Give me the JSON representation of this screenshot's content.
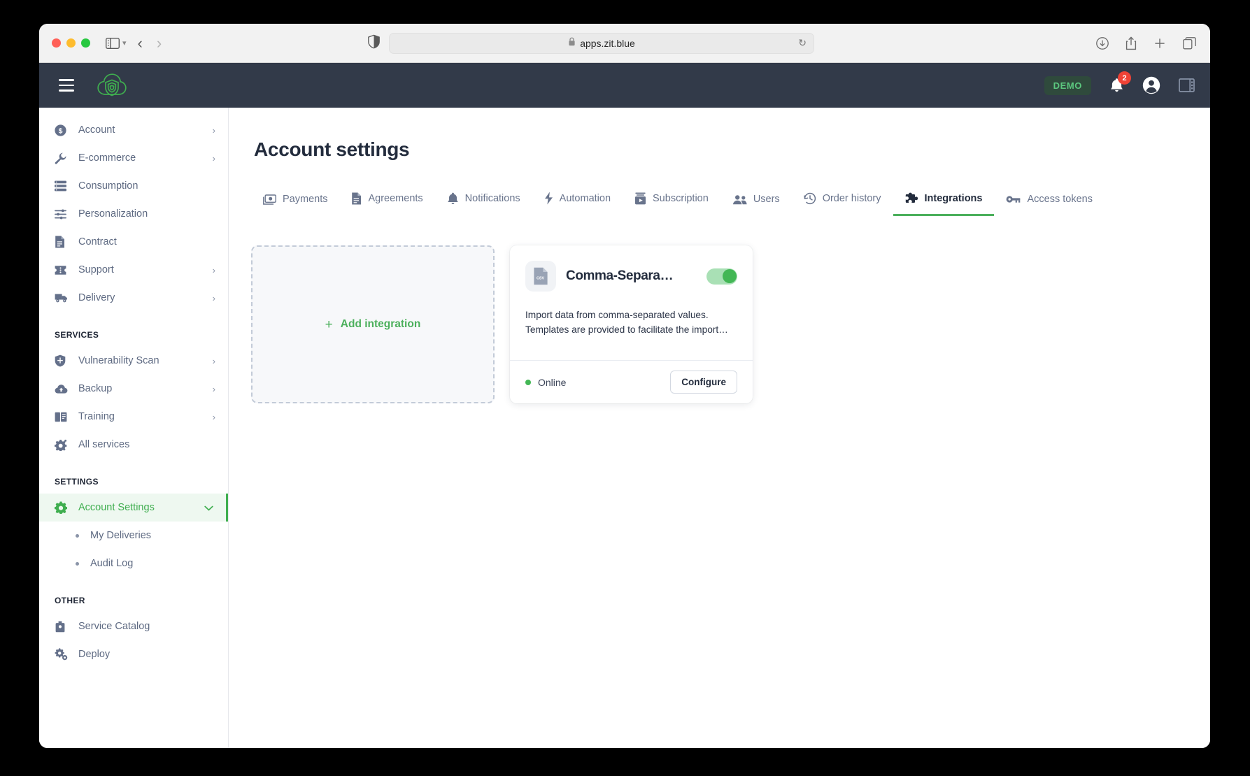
{
  "browser": {
    "url": "apps.zit.blue",
    "lock_icon": "lock-icon",
    "shield_icon": "shield-icon",
    "reload_icon": "reload-icon",
    "sidebar_toggle_icon": "sidebar-toggle-icon",
    "back_icon": "back-arrow-icon",
    "forward_icon": "forward-arrow-icon",
    "download_icon": "download-icon",
    "share_icon": "share-icon",
    "new_tab_icon": "plus-icon",
    "tab_overview_icon": "tab-overview-icon"
  },
  "header": {
    "menu_icon": "hamburger-menu-icon",
    "logo_icon": "cloud-shield-logo-icon",
    "demo_badge": "DEMO",
    "notification_icon": "bell-icon",
    "notification_count": "2",
    "account_icon": "account-circle-icon",
    "panel_icon": "side-panel-icon"
  },
  "sidebar": {
    "items": [
      {
        "label": "Account",
        "icon": "dollar-circle-icon",
        "chevron": "›"
      },
      {
        "label": "E-commerce",
        "icon": "wrench-icon",
        "chevron": "›"
      },
      {
        "label": "Consumption",
        "icon": "list-server-icon",
        "chevron": ""
      },
      {
        "label": "Personalization",
        "icon": "sliders-icon",
        "chevron": ""
      },
      {
        "label": "Contract",
        "icon": "document-icon",
        "chevron": ""
      },
      {
        "label": "Support",
        "icon": "ticket-icon",
        "chevron": "›"
      },
      {
        "label": "Delivery",
        "icon": "truck-icon",
        "chevron": "›"
      }
    ],
    "services_title": "SERVICES",
    "services": [
      {
        "label": "Vulnerability Scan",
        "icon": "shield-icon",
        "chevron": "›"
      },
      {
        "label": "Backup",
        "icon": "cloud-upload-icon",
        "chevron": "›"
      },
      {
        "label": "Training",
        "icon": "book-icon",
        "chevron": "›"
      },
      {
        "label": "All services",
        "icon": "gear-sparkle-icon",
        "chevron": ""
      }
    ],
    "settings_title": "SETTINGS",
    "settings": [
      {
        "label": "Account Settings",
        "icon": "gear-icon",
        "chevron": "⌄",
        "active": true
      }
    ],
    "settings_sub": [
      {
        "label": "My Deliveries"
      },
      {
        "label": "Audit Log"
      }
    ],
    "other_title": "OTHER",
    "other": [
      {
        "label": "Service Catalog",
        "icon": "briefcase-icon",
        "chevron": ""
      },
      {
        "label": "Deploy",
        "icon": "gears-icon",
        "chevron": ""
      }
    ]
  },
  "main": {
    "page_title": "Account settings",
    "tabs": [
      {
        "label": "Payments",
        "icon": "money-icon",
        "active": false
      },
      {
        "label": "Agreements",
        "icon": "document-icon",
        "active": false
      },
      {
        "label": "Notifications",
        "icon": "bell-icon",
        "active": false
      },
      {
        "label": "Automation",
        "icon": "lightning-bolt-icon",
        "active": false
      },
      {
        "label": "Subscription",
        "icon": "subscription-box-icon",
        "active": false
      },
      {
        "label": "Users",
        "icon": "people-icon",
        "active": false
      },
      {
        "label": "Order history",
        "icon": "clock-history-icon",
        "active": false
      },
      {
        "label": "Integrations",
        "icon": "puzzle-piece-icon",
        "active": true
      },
      {
        "label": "Access tokens",
        "icon": "key-icon",
        "active": false
      }
    ],
    "add_integration": {
      "plus": "+",
      "label": "Add integration"
    },
    "integration_card": {
      "icon": "csv-file-icon",
      "title": "Comma-Separa…",
      "toggle_on": true,
      "description": "Import data from comma-separated values. Templates are provided to facilitate the import…",
      "status": "Online",
      "status_color": "#43b755",
      "configure_label": "Configure"
    }
  },
  "colors": {
    "accent_green": "#4cb05c",
    "header_dark": "#323a49",
    "badge_red": "#ef4236"
  }
}
